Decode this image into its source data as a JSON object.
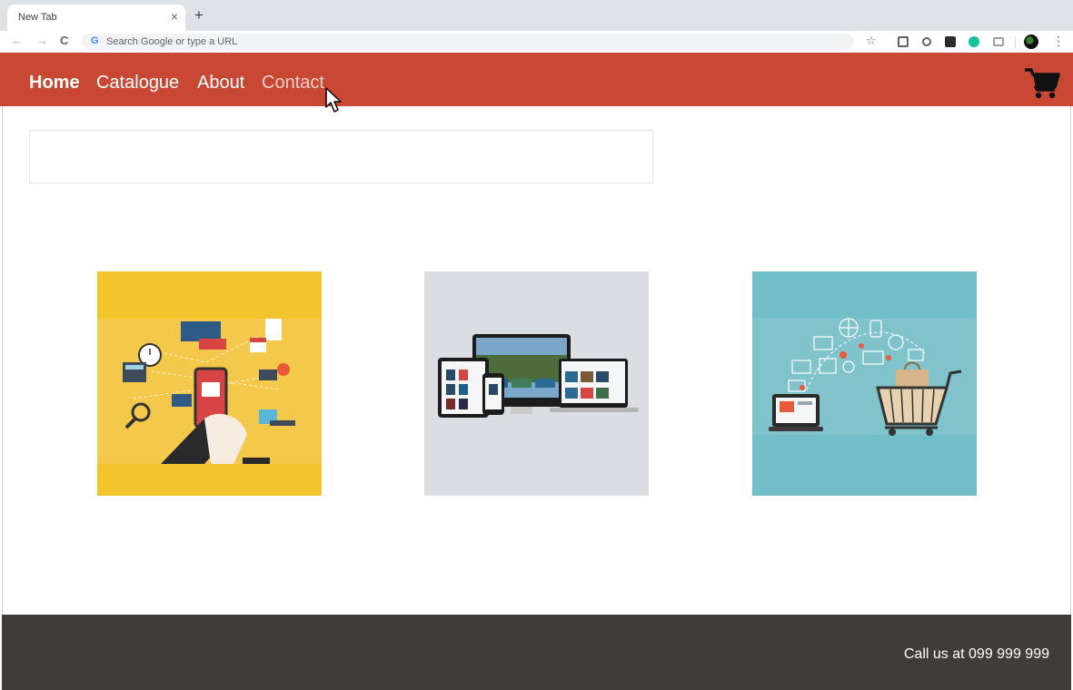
{
  "browser": {
    "tab_title": "New Tab",
    "tab_close": "×",
    "new_tab": "+",
    "back": "←",
    "forward": "→",
    "reload": "C",
    "omnibox_g": "G",
    "omnibox_placeholder": "Search Google or type a URL",
    "bookmark": "☆",
    "menu": "⋮"
  },
  "site": {
    "nav": [
      "Home",
      "Catalogue",
      "About",
      "Contact"
    ],
    "cart_icon": "shopping-cart-icon",
    "accent_color": "#c84834",
    "footer_text": "Call us at 099 999 999"
  },
  "cards": [
    {
      "name": "mobile-commerce-illustration",
      "bg": "#f2c52d"
    },
    {
      "name": "responsive-devices-illustration",
      "bg": "#dadee2"
    },
    {
      "name": "online-shopping-illustration",
      "bg": "#72bfc9"
    }
  ]
}
